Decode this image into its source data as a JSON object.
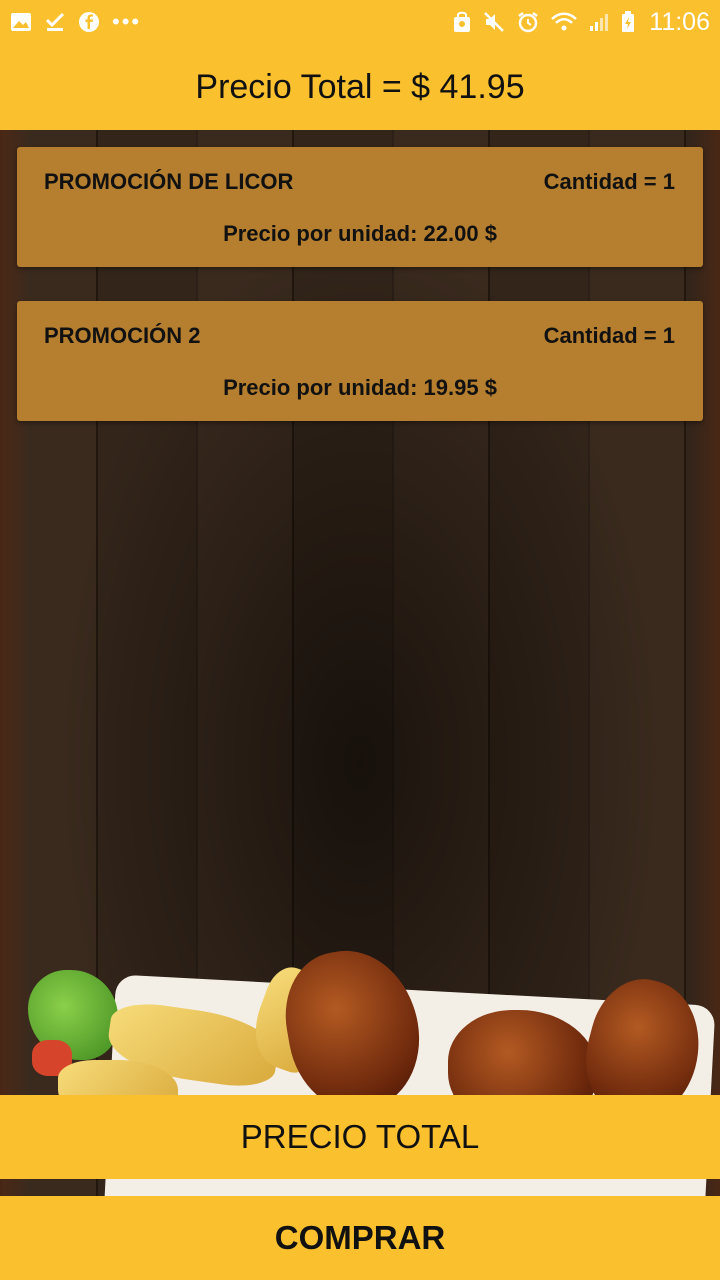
{
  "status_bar": {
    "time": "11:06",
    "left_icons": [
      "image-icon",
      "check-download-icon",
      "facebook-icon"
    ],
    "more_indicator": "•••",
    "right_icons": [
      "alarm-lock-icon",
      "mute-icon",
      "alarm-clock-icon",
      "wifi-icon",
      "signal-icon",
      "battery-icon"
    ]
  },
  "header": {
    "title": "Precio Total = $ 41.95"
  },
  "orders": [
    {
      "name": "PROMOCIÓN DE LICOR",
      "quantity": "Cantidad = 1",
      "unit_price": "Precio por unidad: 22.00 $"
    },
    {
      "name": "PROMOCIÓN 2",
      "quantity": "Cantidad = 1",
      "unit_price": "Precio por unidad: 19.95 $"
    }
  ],
  "buttons": {
    "total_label": "PRECIO TOTAL",
    "buy_label": "COMPRAR"
  },
  "colors": {
    "accent": "#fbc02d",
    "card": "#b57f2f",
    "text": "#111111"
  }
}
